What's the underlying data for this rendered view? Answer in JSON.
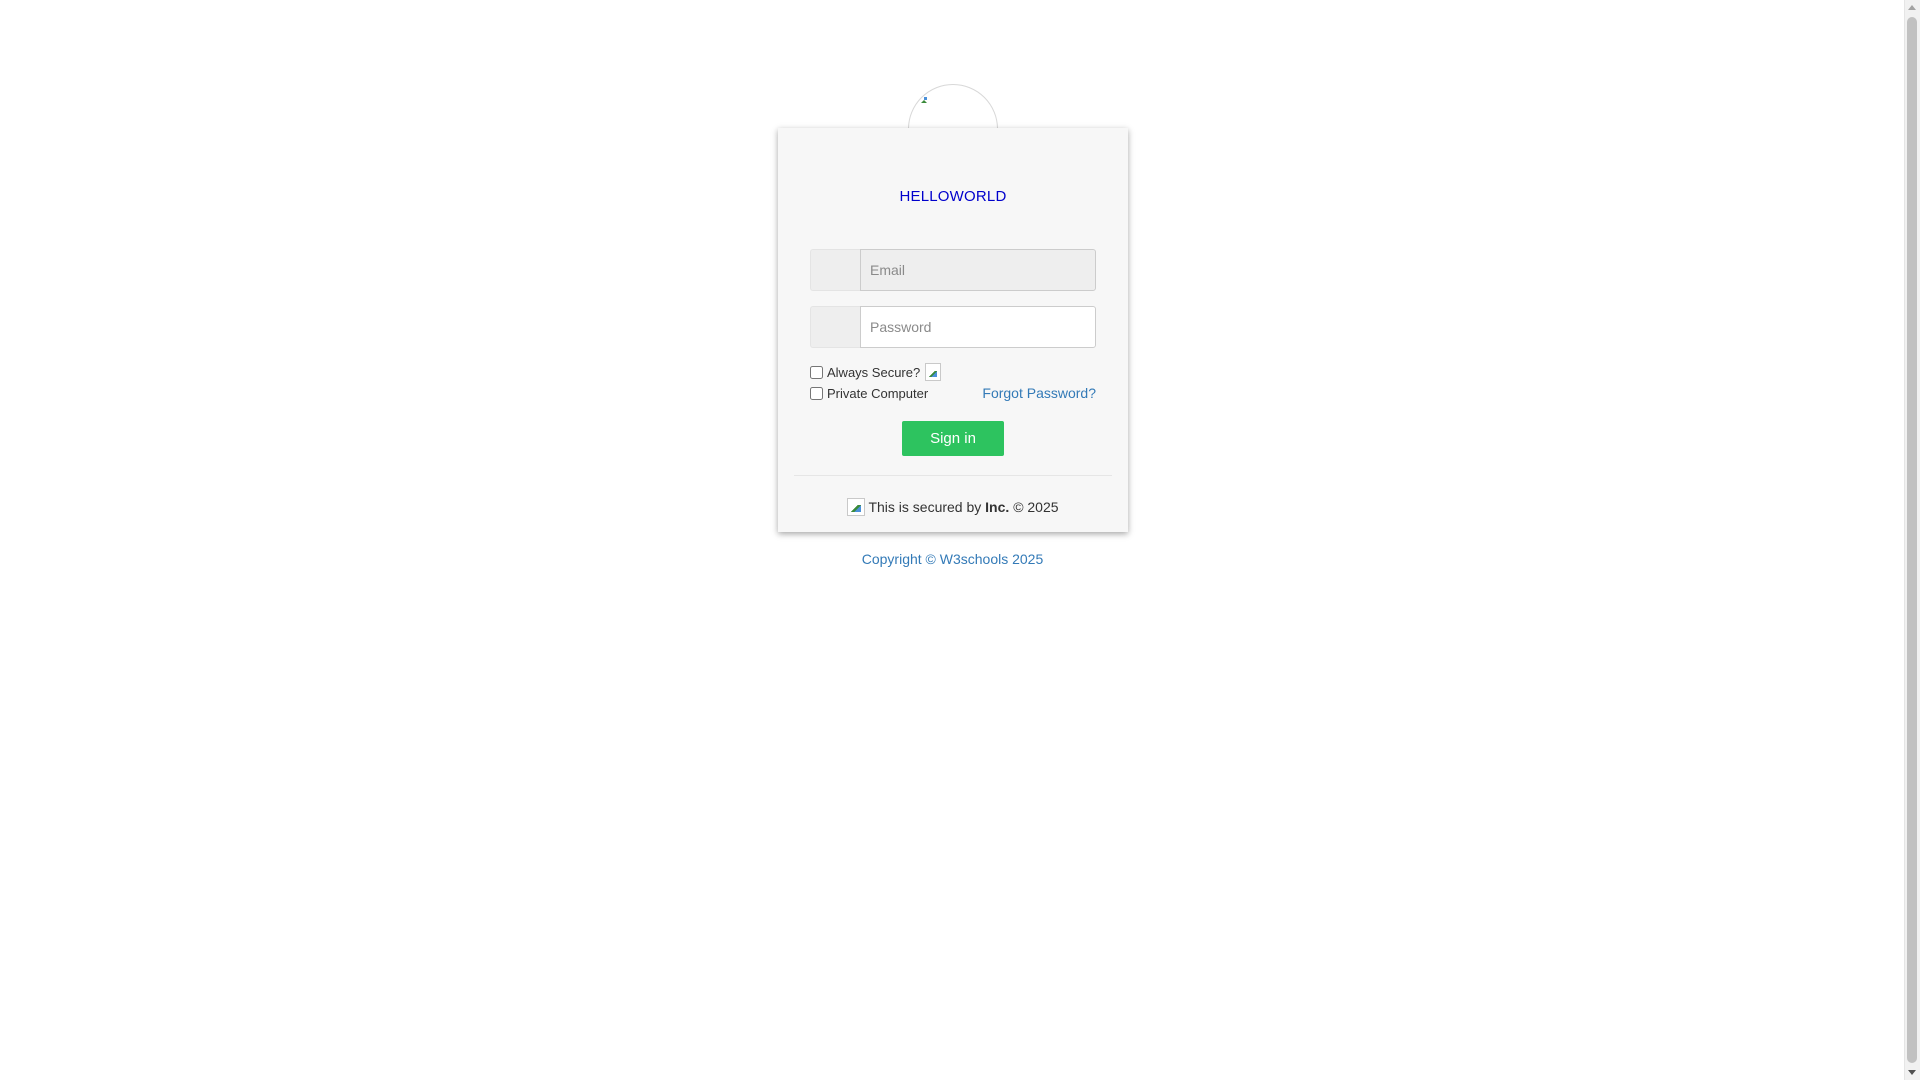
{
  "brand": {
    "name": "HELLOWORLD",
    "color": "#0000cc"
  },
  "login_form": {
    "email_placeholder": "Email",
    "password_placeholder": "Password",
    "always_secure_label": "Always Secure?",
    "always_secure_checked": false,
    "private_computer_label": "Private Computer",
    "private_computer_checked": false,
    "forgot_password_label": "Forgot Password?",
    "signin_label": "Sign in",
    "signin_color": "#2dc35f"
  },
  "footer_card": {
    "secured_prefix": "This is secured by",
    "secured_company": "Inc.",
    "secured_suffix": "© 2025"
  },
  "copyright": "Copyright © W3schools 2025",
  "icons": {
    "logo": "broken-image-icon",
    "info": "broken-image-icon",
    "secured": "broken-image-icon"
  }
}
